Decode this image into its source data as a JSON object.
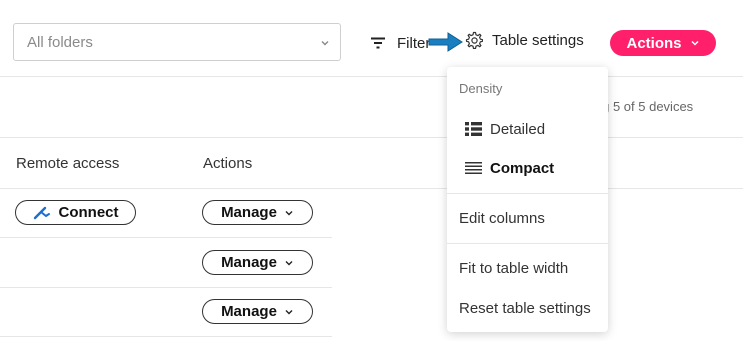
{
  "toolbar": {
    "folder_select": {
      "placeholder": "All folders"
    },
    "filter_label": "Filter",
    "table_settings_label": "Table settings",
    "actions_label": "Actions"
  },
  "status": {
    "device_count": "ing 5 of 5 devices"
  },
  "table": {
    "headers": {
      "remote_access": "Remote access",
      "actions": "Actions"
    },
    "rows": [
      {
        "remote_access": "Connect",
        "action": "Manage"
      },
      {
        "remote_access": "",
        "action": "Manage"
      },
      {
        "remote_access": "",
        "action": "Manage"
      }
    ]
  },
  "table_settings_menu": {
    "density_label": "Density",
    "density_options": [
      "Detailed",
      "Compact"
    ],
    "selected_density": "Compact",
    "edit_columns": "Edit columns",
    "fit_to_width": "Fit to table width",
    "reset": "Reset table settings"
  },
  "colors": {
    "accent": "#ff1f6a",
    "arrow": "#1a7fc1"
  },
  "icons": {
    "filter": "filter-icon",
    "settings": "gear-icon",
    "connect": "remote-connect-icon",
    "detailed": "list-detailed-icon",
    "compact": "list-compact-icon",
    "chevron": "chevron-down-icon",
    "pointer": "pointer-arrow-icon"
  }
}
